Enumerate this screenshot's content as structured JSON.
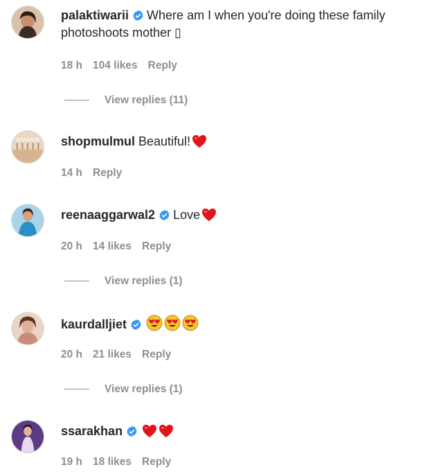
{
  "comments": [
    {
      "username": "palaktiwarii",
      "verified": true,
      "text": "Where am I when you're doing these family",
      "text_line2": "photoshoots mother ▯",
      "time": "18 h",
      "likes": "104 likes",
      "reply_label": "Reply",
      "view_replies": "View replies (11)"
    },
    {
      "username": "shopmulmul",
      "verified": false,
      "text": "Beautiful!",
      "emoji": [
        "red-heart"
      ],
      "time": "14 h",
      "reply_label": "Reply"
    },
    {
      "username": "reenaaggarwal2",
      "verified": true,
      "text": "Love",
      "emoji": [
        "red-heart"
      ],
      "time": "20 h",
      "likes": "14 likes",
      "reply_label": "Reply",
      "view_replies": "View replies (1)"
    },
    {
      "username": "kaurdalljiet",
      "verified": true,
      "text": "",
      "emoji": [
        "heart-eyes",
        "heart-eyes",
        "heart-eyes"
      ],
      "time": "20 h",
      "likes": "21 likes",
      "reply_label": "Reply",
      "view_replies": "View replies (1)"
    },
    {
      "username": "ssarakhan",
      "verified": true,
      "text": "",
      "emoji": [
        "red-heart",
        "red-heart"
      ],
      "time": "19 h",
      "likes": "18 likes",
      "reply_label": "Reply"
    }
  ],
  "colors": {
    "text": "#262626",
    "meta": "#8e8e8e",
    "verified_badge": "#3897f0",
    "heart": "#e0161b"
  }
}
